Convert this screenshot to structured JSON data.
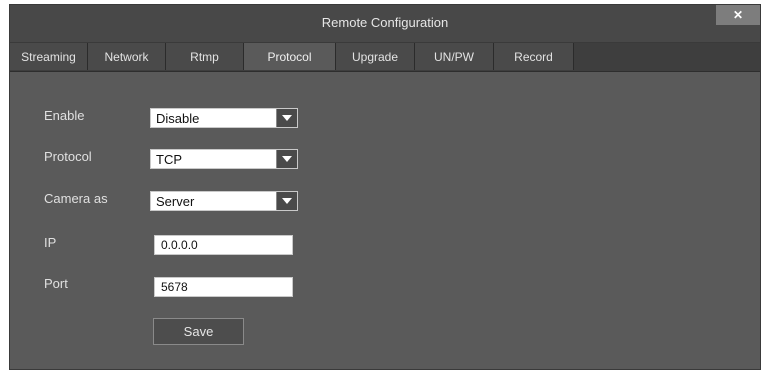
{
  "window": {
    "title": "Remote Configuration",
    "close_glyph": "✕"
  },
  "tabs": [
    {
      "label": "Streaming"
    },
    {
      "label": "Network"
    },
    {
      "label": "Rtmp"
    },
    {
      "label": "Protocol"
    },
    {
      "label": "Upgrade"
    },
    {
      "label": "UN/PW"
    },
    {
      "label": "Record"
    }
  ],
  "active_tab": "Protocol",
  "form": {
    "enable": {
      "label": "Enable",
      "value": "Disable"
    },
    "protocol": {
      "label": "Protocol",
      "value": "TCP"
    },
    "camera_as": {
      "label": "Camera as",
      "value": "Server"
    },
    "ip": {
      "label": "IP",
      "value": "0.0.0.0"
    },
    "port": {
      "label": "Port",
      "value": "5678"
    },
    "save_label": "Save"
  },
  "icons": {
    "close": "close-icon",
    "dropdown": "chevron-down-icon"
  },
  "colors": {
    "background": "#5a5a5a",
    "titlebar": "#484848",
    "tabbar": "#3e3e3e",
    "input": "#ffffff"
  }
}
